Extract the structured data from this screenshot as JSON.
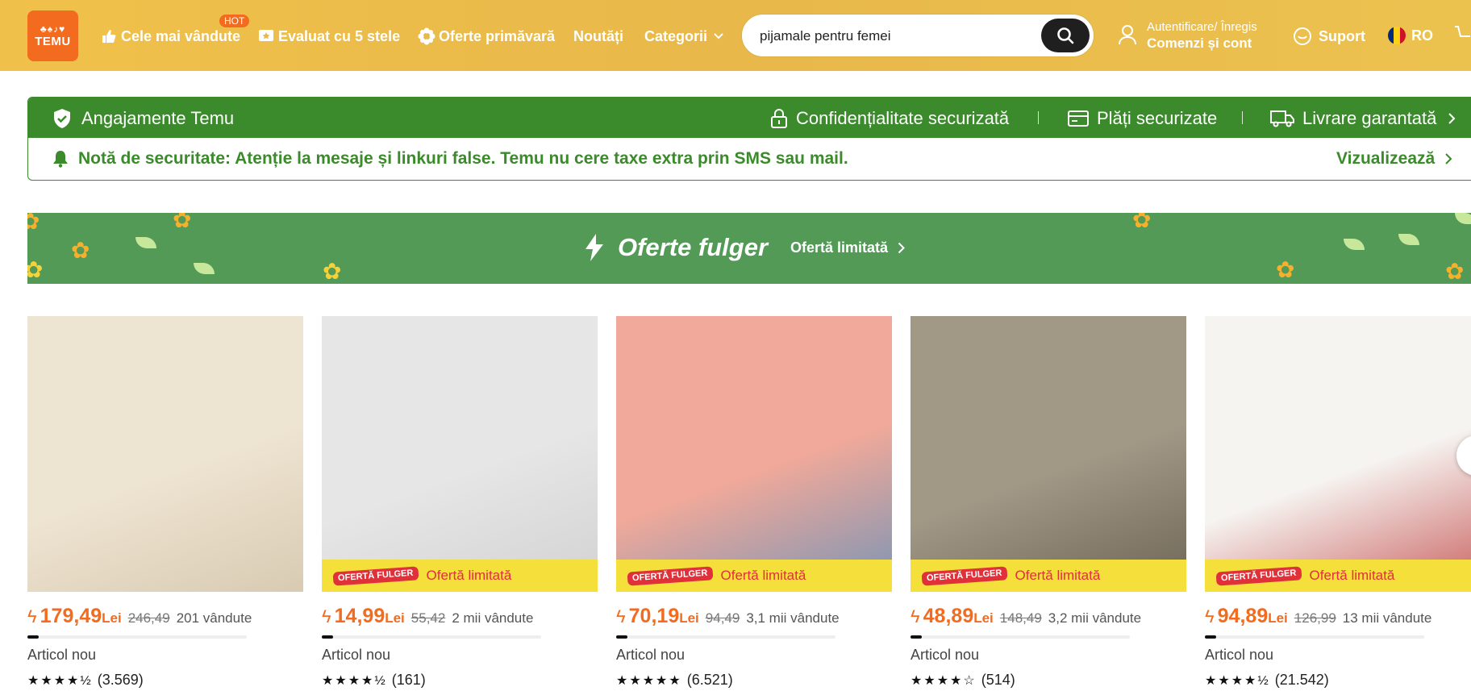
{
  "header": {
    "logo_text": "TEMU",
    "nav": {
      "bestsellers": "Cele mai vândute",
      "hot_badge": "HOT",
      "five_stars": "Evaluat cu 5 stele",
      "spring": "Oferte primăvară",
      "news": "Noutăți",
      "categories": "Categorii"
    },
    "search_value": "pijamale pentru femei",
    "account_line1": "Autentificare/ Înregis",
    "account_line2": "Comenzi și cont",
    "support": "Suport",
    "lang": "RO"
  },
  "commitments": {
    "title": "Angajamente Temu",
    "privacy": "Confidențialitate securizată",
    "payments": "Plăți securizate",
    "delivery": "Livrare garantată",
    "notice": "Notă de securitate: Atenție la mesaje și linkuri false. Temu nu cere taxe extra prin SMS sau mail.",
    "view": "Vizualizează"
  },
  "banner": {
    "title": "Oferte fulger",
    "subtitle": "Ofertă limitată"
  },
  "products": [
    {
      "price": "179,49",
      "currency": "Lei",
      "old_price": "246,49",
      "sold": "201 vândute",
      "label": "Articol nou",
      "reviews": "(3.569)",
      "stars": "★★★★½",
      "limited": false,
      "progress": 0.05,
      "colors": [
        "#eee4d2",
        "#d9cbb2"
      ]
    },
    {
      "price": "14,99",
      "currency": "Lei",
      "old_price": "55,42",
      "sold": "2 mii vândute",
      "label": "Articol nou",
      "reviews": "(161)",
      "stars": "★★★★½",
      "limited": true,
      "badge": "OFERTĂ FULGER",
      "limited_text": "Ofertă limitată",
      "progress": 0.05,
      "colors": [
        "#e6e6e6",
        "#d2d2d2"
      ]
    },
    {
      "price": "70,19",
      "currency": "Lei",
      "old_price": "94,49",
      "sold": "3,1 mii vândute",
      "label": "Articol nou",
      "reviews": "(6.521)",
      "stars": "★★★★★",
      "limited": true,
      "badge": "OFERTĂ FULGER",
      "limited_text": "Ofertă limitată",
      "progress": 0.05,
      "colors": [
        "#f0a99a",
        "#7a94b5"
      ]
    },
    {
      "price": "48,89",
      "currency": "Lei",
      "old_price": "148,49",
      "sold": "3,2 mii vândute",
      "label": "Articol nou",
      "reviews": "(514)",
      "stars": "★★★★☆",
      "limited": true,
      "badge": "OFERTĂ FULGER",
      "limited_text": "Ofertă limitată",
      "progress": 0.05,
      "colors": [
        "#a29886",
        "#6d6556"
      ]
    },
    {
      "price": "94,89",
      "currency": "Lei",
      "old_price": "126,99",
      "sold": "13 mii vândute",
      "label": "Articol nou",
      "reviews": "(21.542)",
      "stars": "★★★★½",
      "limited": true,
      "badge": "OFERTĂ FULGER",
      "limited_text": "Ofertă limitată",
      "progress": 0.05,
      "colors": [
        "#f6f4f1",
        "#c9605e"
      ]
    }
  ]
}
